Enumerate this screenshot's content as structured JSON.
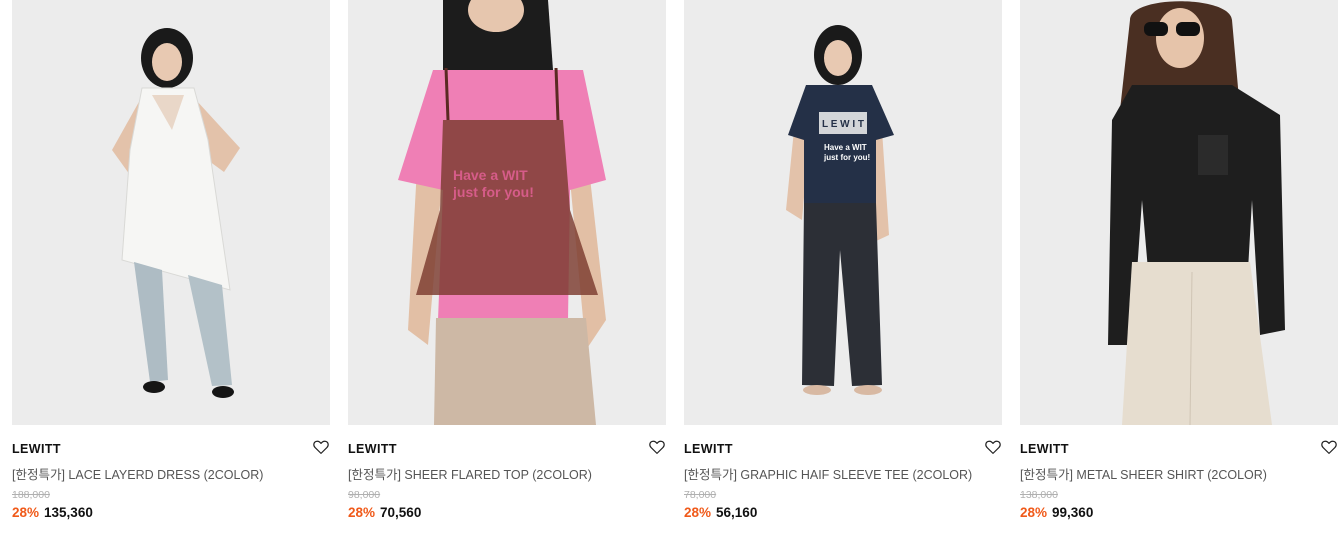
{
  "colors": {
    "discount": "#f05a1a",
    "text": "#111111",
    "name_text": "#555555",
    "original_price": "#b0b0b0",
    "photo_bg": "#ebebeb"
  },
  "products": [
    {
      "brand": "LEWITT",
      "name": "[한정특가] LACE LAYERD DRESS (2COLOR)",
      "original_price": "188,000",
      "discount": "28%",
      "price": "135,360",
      "wishlist_icon": "heart-outline-icon"
    },
    {
      "brand": "LEWITT",
      "name": "[한정특가] SHEER FLARED TOP (2COLOR)",
      "original_price": "98,000",
      "discount": "28%",
      "price": "70,560",
      "wishlist_icon": "heart-outline-icon"
    },
    {
      "brand": "LEWITT",
      "name": "[한정특가] GRAPHIC HAIF SLEEVE TEE (2COLOR)",
      "original_price": "78,000",
      "discount": "28%",
      "price": "56,160",
      "wishlist_icon": "heart-outline-icon"
    },
    {
      "brand": "LEWITT",
      "name": "[한정특가] METAL SHEER SHIRT (2COLOR)",
      "original_price": "138,000",
      "discount": "28%",
      "price": "99,360",
      "wishlist_icon": "heart-outline-icon"
    }
  ]
}
